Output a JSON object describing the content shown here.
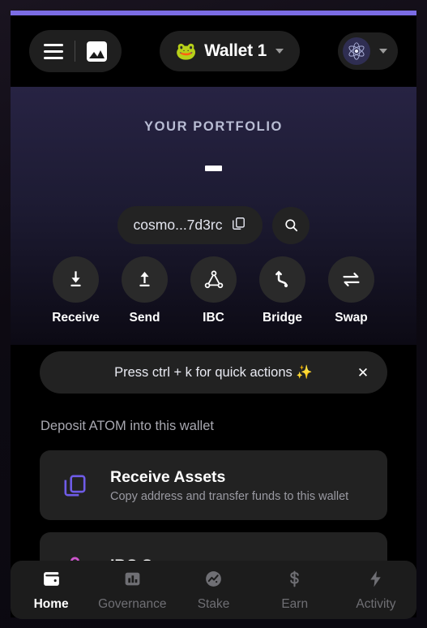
{
  "theme": {
    "accent_bar": "#7b6ce4",
    "card_bg": "#222222",
    "page_bg": "#000000",
    "receive_icon_color": "#6f5ce8",
    "ibc_icon_color": "#cc55cc",
    "active_nav_color": "#ffffff",
    "inactive_nav_color": "#6f6f74"
  },
  "header": {
    "menu_icon": "hamburger-icon",
    "gallery_icon": "image-icon",
    "wallet": {
      "emoji": "🐸",
      "name": "Wallet 1",
      "chevron": "chevron-down-icon"
    },
    "network": {
      "logo": "cosmos-atom-icon",
      "chevron": "chevron-down-icon"
    }
  },
  "portfolio": {
    "title": "YOUR PORTFOLIO",
    "balance_placeholder": "—",
    "address": "cosmo...7d3rc",
    "copy_icon": "copy-icon",
    "search_icon": "search-icon"
  },
  "actions": [
    {
      "label": "Receive",
      "icon": "download-arrow-icon"
    },
    {
      "label": "Send",
      "icon": "upload-arrow-icon"
    },
    {
      "label": "IBC",
      "icon": "ibc-nodes-icon"
    },
    {
      "label": "Bridge",
      "icon": "bridge-curve-icon"
    },
    {
      "label": "Swap",
      "icon": "swap-arrows-icon"
    }
  ],
  "banner": {
    "text": "Press ctrl + k for quick actions ✨",
    "close_label": "✕"
  },
  "deposit": {
    "section_label": "Deposit ATOM into this wallet",
    "cards": [
      {
        "title": "Receive Assets",
        "subtitle": "Copy address and transfer funds to this wallet",
        "icon": "copy-icon"
      },
      {
        "title": "IBC Swaps",
        "subtitle": "",
        "icon": "ibc-swap-icon"
      }
    ]
  },
  "bottom_nav": [
    {
      "label": "Home",
      "icon": "wallet-icon",
      "active": true
    },
    {
      "label": "Governance",
      "icon": "bar-chart-icon",
      "active": false
    },
    {
      "label": "Stake",
      "icon": "trending-chart-icon",
      "active": false
    },
    {
      "label": "Earn",
      "icon": "dollar-sign-icon",
      "active": false
    },
    {
      "label": "Activity",
      "icon": "lightning-bolt-icon",
      "active": false
    }
  ]
}
